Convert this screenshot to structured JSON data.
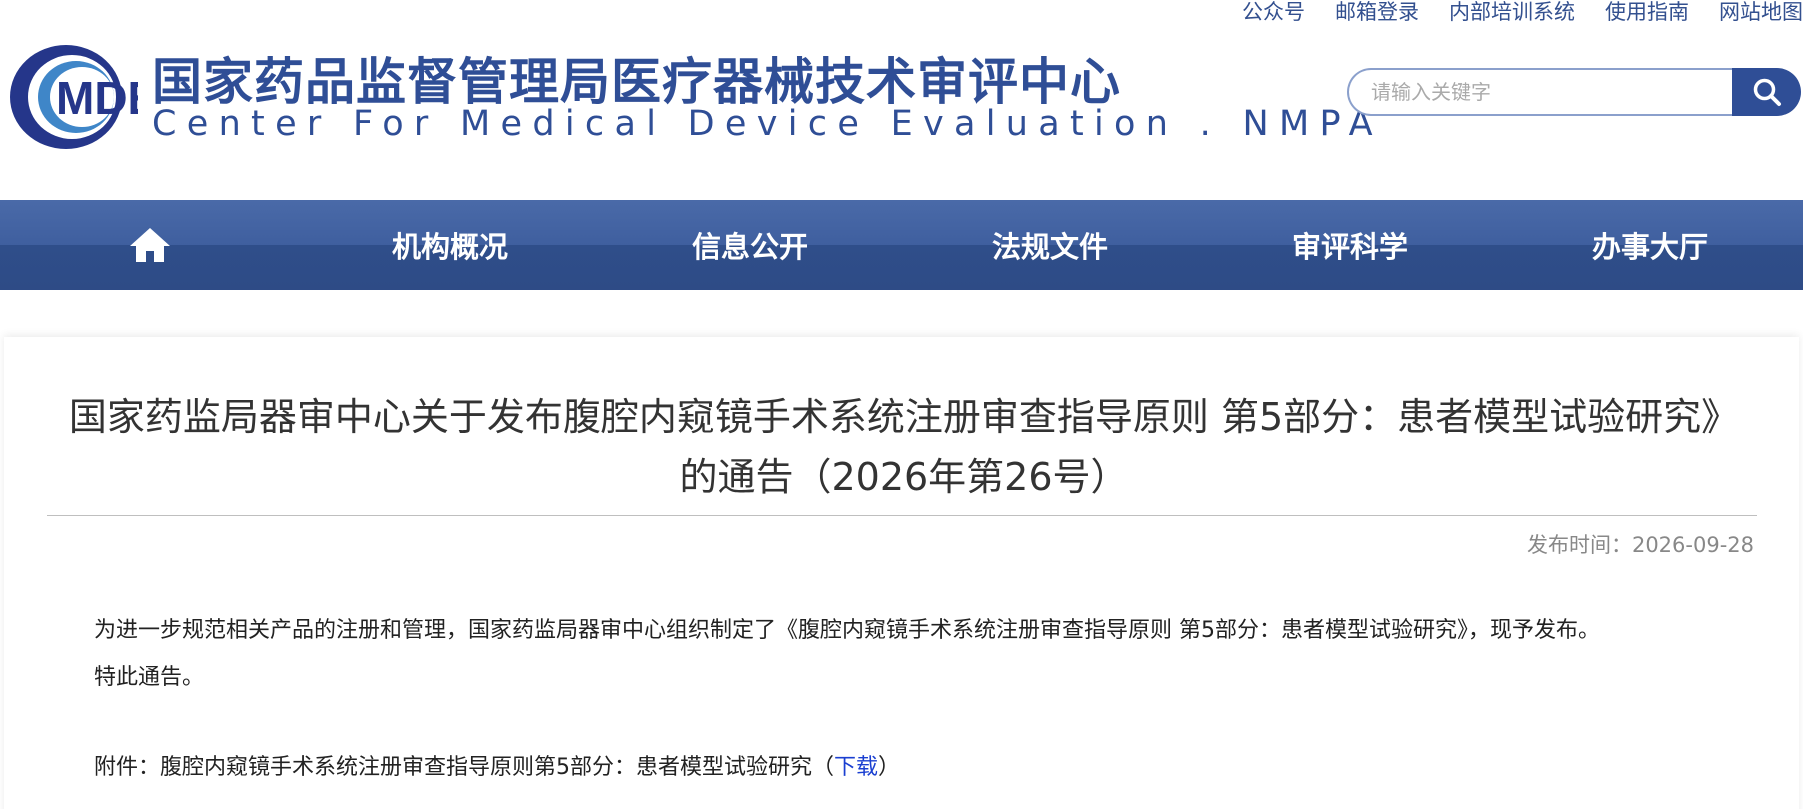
{
  "top_links": [
    "公众号",
    "邮箱登录",
    "内部培训系统",
    "使用指南",
    "网站地图"
  ],
  "logo": {
    "text": "MDE"
  },
  "site_title_cn": "国家药品监督管理局医疗器械技术审评中心",
  "site_title_en": "Center For Medical Device Evaluation . NMPA",
  "search": {
    "placeholder": "请输入关键字"
  },
  "nav": {
    "home_icon": "home-icon",
    "items": [
      "机构概况",
      "信息公开",
      "法规文件",
      "审评科学",
      "办事大厅"
    ]
  },
  "article": {
    "title": "国家药监局器审中心关于发布腹腔内窥镜手术系统注册审查指导原则 第5部分：患者模型试验研究》的通告（2026年第26号）",
    "pub_label": "发布时间：",
    "pub_date": "2026-09-28",
    "paragraph1": "为进一步规范相关产品的注册和管理，国家药监局器审中心组织制定了《腹腔内窥镜手术系统注册审查指导原则 第5部分：患者模型试验研究》，现予发布。",
    "paragraph2": "特此通告。",
    "attachment_prefix": "附件：腹腔内窥镜手术系统注册审查指导原则第5部分：患者模型试验研究（",
    "attachment_link": "下载",
    "attachment_suffix": "）"
  },
  "colors": {
    "brand": "#2f4e96",
    "nav_bg": "#3f5f9f",
    "link": "#1a3fd1"
  }
}
